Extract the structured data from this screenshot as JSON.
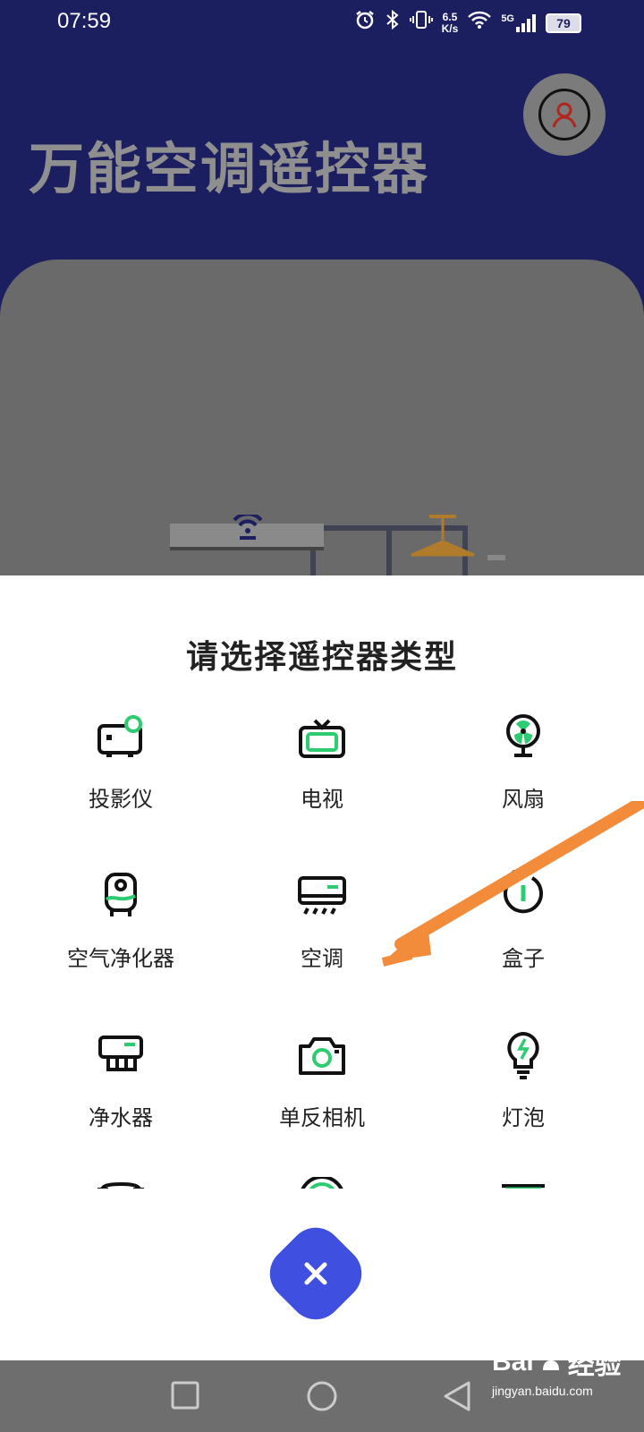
{
  "status_bar": {
    "time": "07:59",
    "speed_value": "6.5",
    "speed_unit": "K/s",
    "network": "5G",
    "battery": "79"
  },
  "header": {
    "title": "万能空调遥控器"
  },
  "sheet": {
    "title": "请选择遥控器类型",
    "items": [
      {
        "label": "投影仪",
        "icon": "projector-icon"
      },
      {
        "label": "电视",
        "icon": "tv-icon"
      },
      {
        "label": "风扇",
        "icon": "fan-icon"
      },
      {
        "label": "空气净化器",
        "icon": "air-purifier-icon"
      },
      {
        "label": "空调",
        "icon": "air-conditioner-icon"
      },
      {
        "label": "盒子",
        "icon": "box-icon"
      },
      {
        "label": "净水器",
        "icon": "water-purifier-icon"
      },
      {
        "label": "单反相机",
        "icon": "camera-icon"
      },
      {
        "label": "灯泡",
        "icon": "bulb-icon"
      }
    ]
  },
  "watermark": {
    "brand": "Bai",
    "brand_suffix": "经验",
    "url": "jingyan.baidu.com"
  },
  "colors": {
    "header_bg": "#1b1f60",
    "accent_green": "#2ecc71",
    "close_button": "#3f4fe0",
    "arrow": "#f28b3a"
  }
}
